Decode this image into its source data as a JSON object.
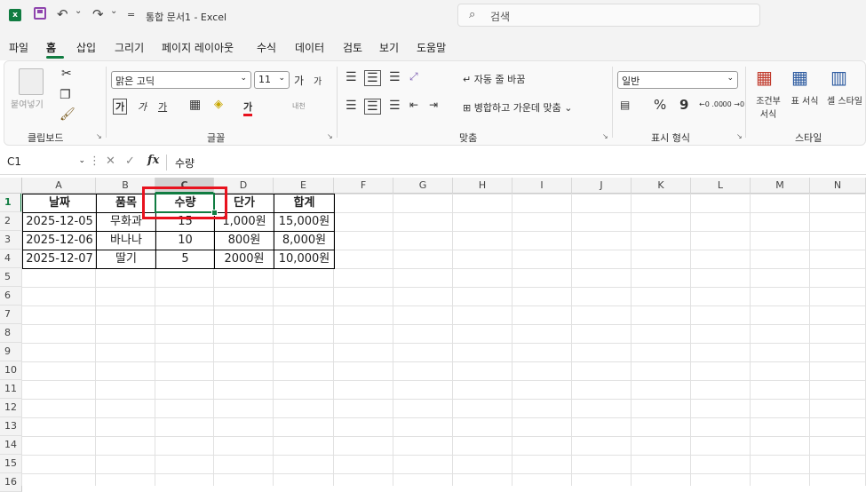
{
  "titlebar": {
    "logo": "x",
    "title": "통합 문서1 - Excel",
    "search_placeholder": "검색",
    "undo_glyph": "↶",
    "redo_glyph": "↷",
    "dropdown_glyph": "⌄",
    "customize_glyph": "="
  },
  "tabs": [
    "파일",
    "홈",
    "삽입",
    "그리기",
    "페이지 레이아웃",
    "수식",
    "데이터",
    "검토",
    "보기",
    "도움말"
  ],
  "active_tab": "홈",
  "ribbon": {
    "clipboard": {
      "label": "클립보드",
      "paste": "붙여넣기",
      "cut_icon": "scissors-icon",
      "copy_icon": "copy-icon",
      "format_painter_icon": "brush-icon"
    },
    "font": {
      "label": "글꼴",
      "font_name": "맑은 고딕",
      "font_size": "11",
      "grow": "가",
      "shrink": "가",
      "bold": "가",
      "italic": "가",
      "underline": "가",
      "color": "가",
      "phonetic": "내천"
    },
    "alignment": {
      "label": "맞춤",
      "wrap": "자동 줄 바꿈",
      "merge": "병합하고 가운데 맞춤"
    },
    "number": {
      "label": "표시 형식",
      "format": "일반",
      "percent": "%",
      "comma": "9",
      "inc_dec": "←0 .00",
      "dec_dec": ".00 →0"
    },
    "styles": {
      "label": "스타일",
      "conditional": "조건부 서식",
      "table": "표 서식",
      "cell": "셀 스타일"
    }
  },
  "formula_bar": {
    "name_box": "C1",
    "content": "수량",
    "fx": "fx"
  },
  "columns": [
    "A",
    "B",
    "C",
    "D",
    "E",
    "F",
    "G",
    "H",
    "I",
    "J",
    "K",
    "L",
    "M",
    "N"
  ],
  "rows": [
    "1",
    "2",
    "3",
    "4",
    "5",
    "6",
    "7",
    "8",
    "9",
    "10",
    "11",
    "12",
    "13",
    "14",
    "15",
    "16"
  ],
  "selected_cell": "C1",
  "table": {
    "headers": [
      "날짜",
      "품목",
      "수량",
      "단가",
      "합계"
    ],
    "rows": [
      [
        "2025-12-05",
        "무화과",
        "15",
        "1,000원",
        "15,000원"
      ],
      [
        "2025-12-06",
        "바나나",
        "10",
        "800원",
        "8,000원"
      ],
      [
        "2025-12-07",
        "딸기",
        "5",
        "2000원",
        "10,000원"
      ]
    ]
  },
  "annotation_color": "#e8121e",
  "accent": "#107c41"
}
